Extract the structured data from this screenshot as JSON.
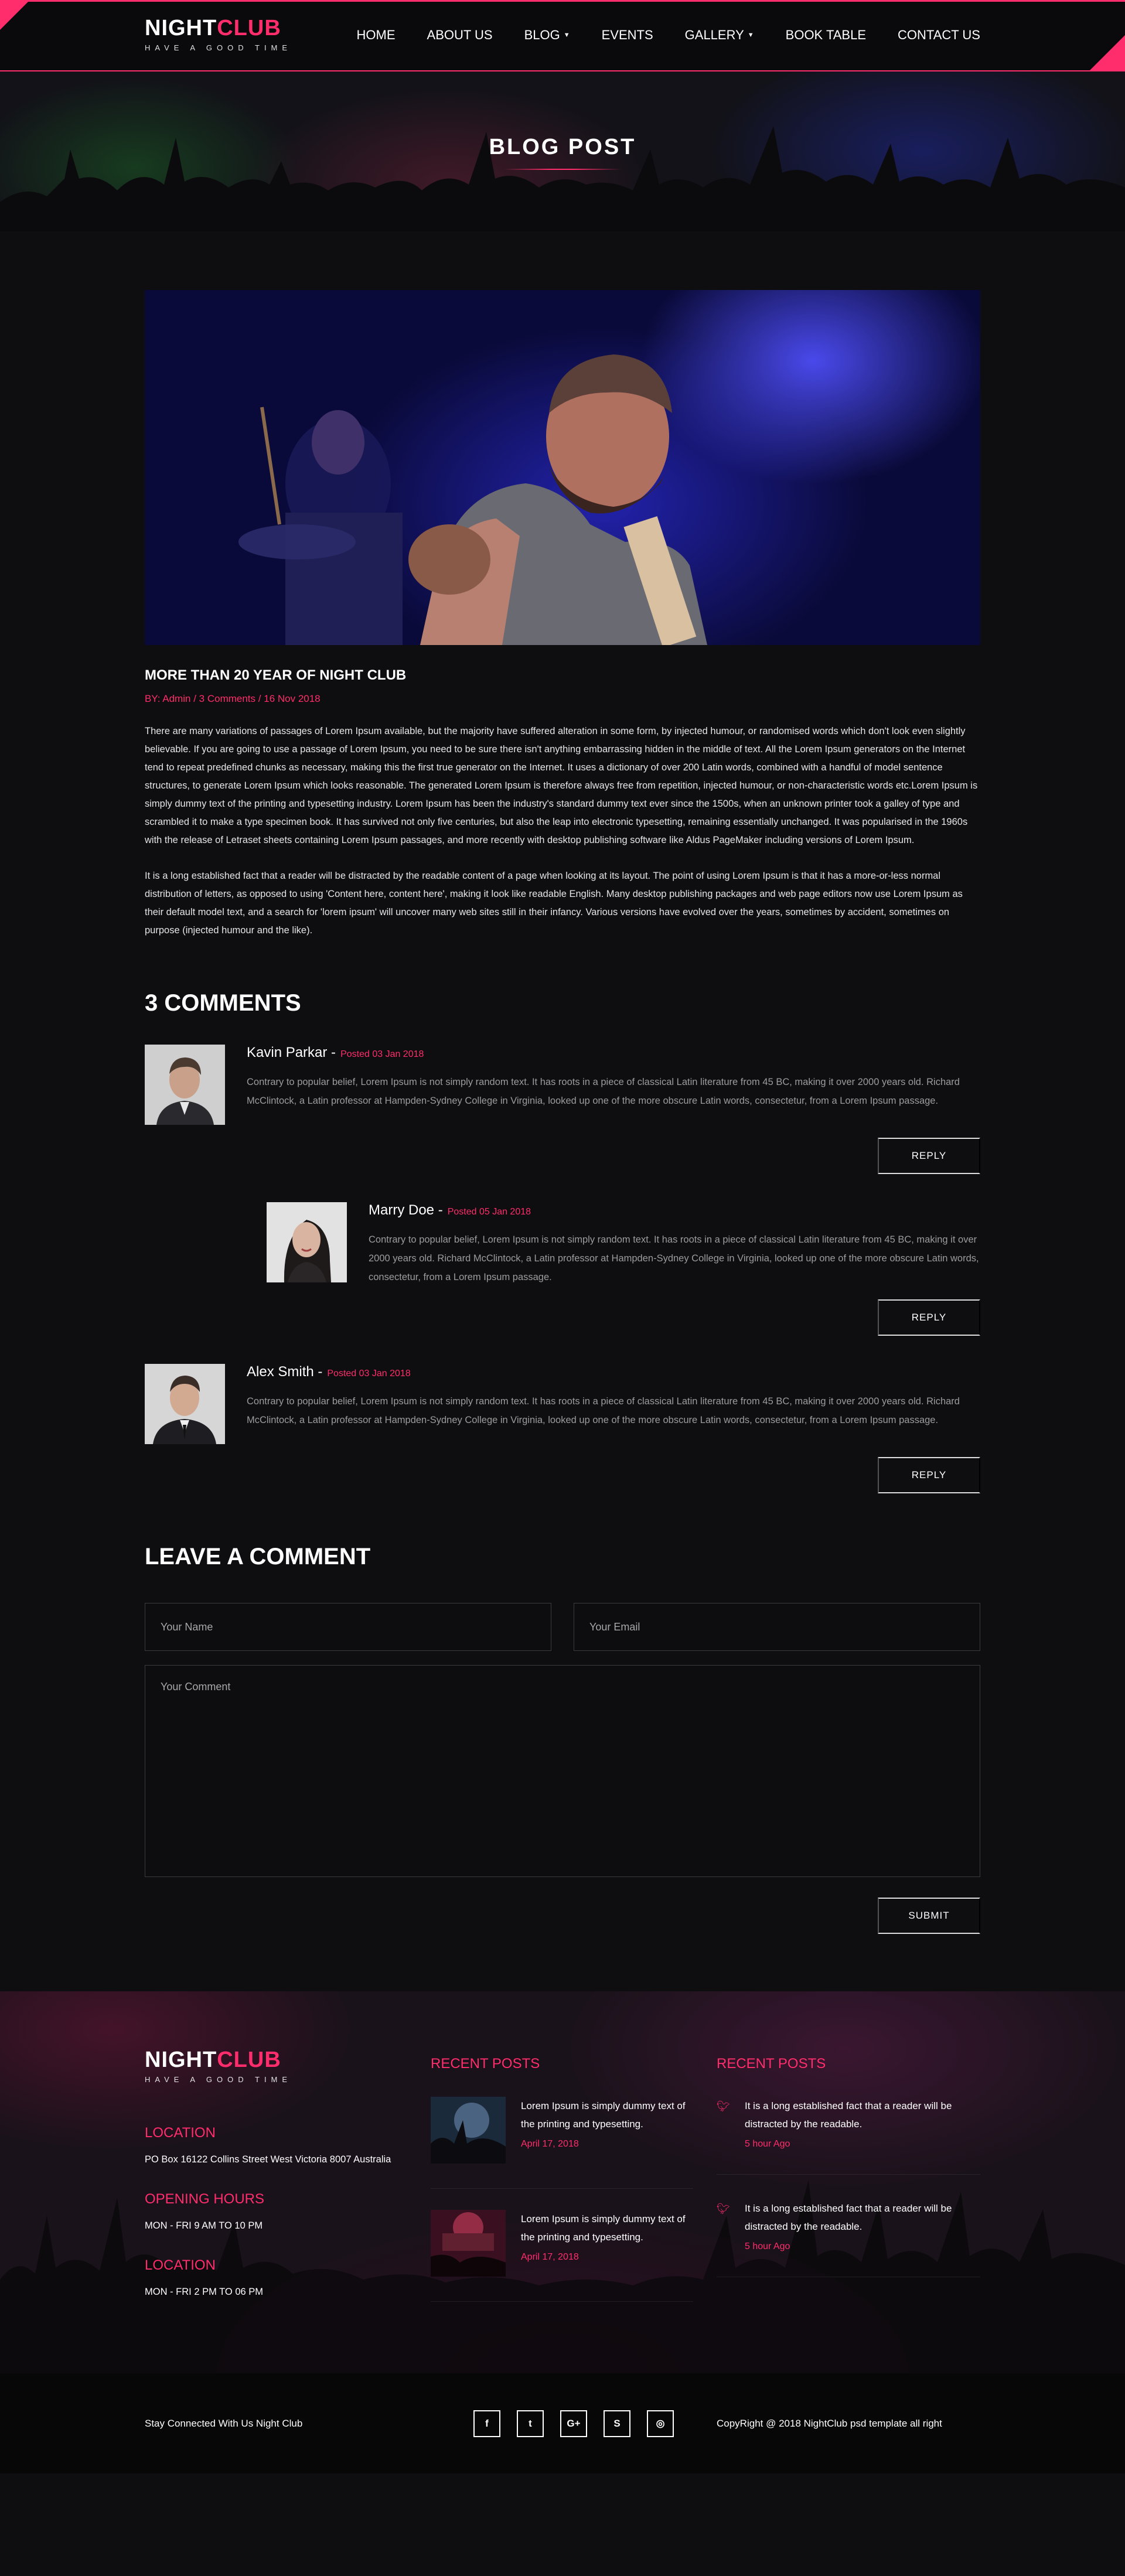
{
  "brand": {
    "name_a": "NIGHT",
    "name_b": "CLUB",
    "tagline": "HAVE A GOOD TIME"
  },
  "nav": [
    {
      "label": "HOME",
      "caret": false
    },
    {
      "label": "ABOUT US",
      "caret": false
    },
    {
      "label": "BLOG",
      "caret": true
    },
    {
      "label": "EVENTS",
      "caret": false
    },
    {
      "label": "GALLERY",
      "caret": true
    },
    {
      "label": "BOOK TABLE",
      "caret": false
    },
    {
      "label": "CONTACT US",
      "caret": false
    }
  ],
  "hero": {
    "title": "BLOG POST"
  },
  "post": {
    "title": "MORE THAN 20 YEAR OF NIGHT CLUB",
    "meta_by": "BY:",
    "meta_author": "Admin",
    "meta_comments": "3 Comments",
    "meta_date": "16 Nov 2018",
    "paragraphs": [
      "There are many variations of passages of Lorem Ipsum available, but the majority have suffered alteration in some form, by injected humour, or randomised words which don't look even slightly believable. If you are going to use a passage of Lorem Ipsum, you need to be sure there isn't anything embarrassing hidden in the middle of text. All the Lorem Ipsum generators on the Internet tend to repeat predefined chunks as necessary, making this the first true generator on the Internet. It uses a dictionary of over 200 Latin words, combined with a handful of model sentence structures, to generate Lorem Ipsum which looks reasonable. The generated Lorem Ipsum is therefore always free from repetition, injected humour, or non-characteristic words etc.Lorem Ipsum is simply dummy text of the printing and typesetting industry. Lorem Ipsum has been the industry's standard dummy text ever since the 1500s, when an unknown printer took a galley of type and scrambled it to make a type specimen book. It has survived not only five centuries, but also the leap into electronic typesetting, remaining essentially unchanged. It was popularised in the 1960s with the release of Letraset sheets containing Lorem Ipsum passages, and more recently with desktop publishing software like Aldus PageMaker including versions of Lorem Ipsum.",
      "It is a long established fact that a reader will be distracted by the readable content of a page when looking at its layout. The point of using Lorem Ipsum is that it has a more-or-less normal distribution of letters, as opposed to using 'Content here, content here', making it look like readable English. Many desktop publishing packages and web page editors now use Lorem Ipsum as their default model text, and a search for 'lorem ipsum' will uncover many web sites still in their infancy. Various versions have evolved over the years, sometimes by accident, sometimes on purpose (injected humour and the like)."
    ]
  },
  "comments": {
    "heading": "3 COMMENTS",
    "reply_label": "REPLY",
    "items": [
      {
        "name": "Kavin Parkar -",
        "posted": "Posted 03 Jan 2018",
        "text": "Contrary to popular belief, Lorem Ipsum is not simply random text. It has roots in a piece of classical Latin literature from 45 BC, making it over 2000 years old. Richard McClintock, a Latin professor at Hampden-Sydney College in Virginia, looked up one of the more obscure Latin words, consectetur, from a Lorem Ipsum passage."
      },
      {
        "name": "Marry Doe -",
        "posted": "Posted 05 Jan 2018",
        "text": "Contrary to popular belief, Lorem Ipsum is not simply random text. It has roots in a piece of classical Latin literature from 45 BC, making it over 2000 years old. Richard McClintock, a Latin professor at Hampden-Sydney College in Virginia, looked up one of the more obscure Latin words, consectetur, from a Lorem Ipsum passage."
      },
      {
        "name": "Alex Smith -",
        "posted": "Posted 03 Jan 2018",
        "text": "Contrary to popular belief, Lorem Ipsum is not simply random text. It has roots in a piece of classical Latin literature from 45 BC, making it over 2000 years old. Richard McClintock, a Latin professor at Hampden-Sydney College in Virginia, looked up one of the more obscure Latin words, consectetur, from a Lorem Ipsum passage."
      }
    ]
  },
  "leave_comment": {
    "heading": "LEAVE A COMMENT",
    "name_placeholder": "Your Name",
    "email_placeholder": "Your Email",
    "comment_placeholder": "Your Comment",
    "submit_label": "SUBMIT"
  },
  "footer": {
    "location_heading": "LOCATION",
    "location_text": "PO Box 16122 Collins Street West Victoria 8007 Australia",
    "hours_heading": "OPENING HOURS",
    "hours_text": "MON - FRI 9 AM TO 10 PM",
    "location2_heading": "LOCATION",
    "location2_text": "MON - FRI 2 PM TO 06 PM",
    "recent_heading": "RECENT POSTS",
    "recent_posts": [
      {
        "title": "Lorem Ipsum is simply dummy text of the printing and typesetting.",
        "date": "April 17, 2018"
      },
      {
        "title": "Lorem Ipsum is simply dummy text of the printing and typesetting.",
        "date": "April 17, 2018"
      }
    ],
    "tweets_heading": "RECENT POSTS",
    "tweets": [
      {
        "text": "It is a long established fact that a reader will be distracted by the readable.",
        "time": "5 hour Ago"
      },
      {
        "text": "It is a long established fact that a reader will be distracted by the readable.",
        "time": "5 hour Ago"
      }
    ],
    "stay_connected": "Stay Connected With Us Night Club",
    "socials": [
      {
        "icon": "facebook-icon",
        "glyph": "f"
      },
      {
        "icon": "twitter-icon",
        "glyph": "t"
      },
      {
        "icon": "google-plus-icon",
        "glyph": "G+"
      },
      {
        "icon": "skype-icon",
        "glyph": "S"
      },
      {
        "icon": "dribbble-icon",
        "glyph": "◎"
      }
    ],
    "copyright": "CopyRight @ 2018 NightClub psd template all right"
  },
  "colors": {
    "accent": "#ff2d6b",
    "background": "#0e0e10"
  }
}
